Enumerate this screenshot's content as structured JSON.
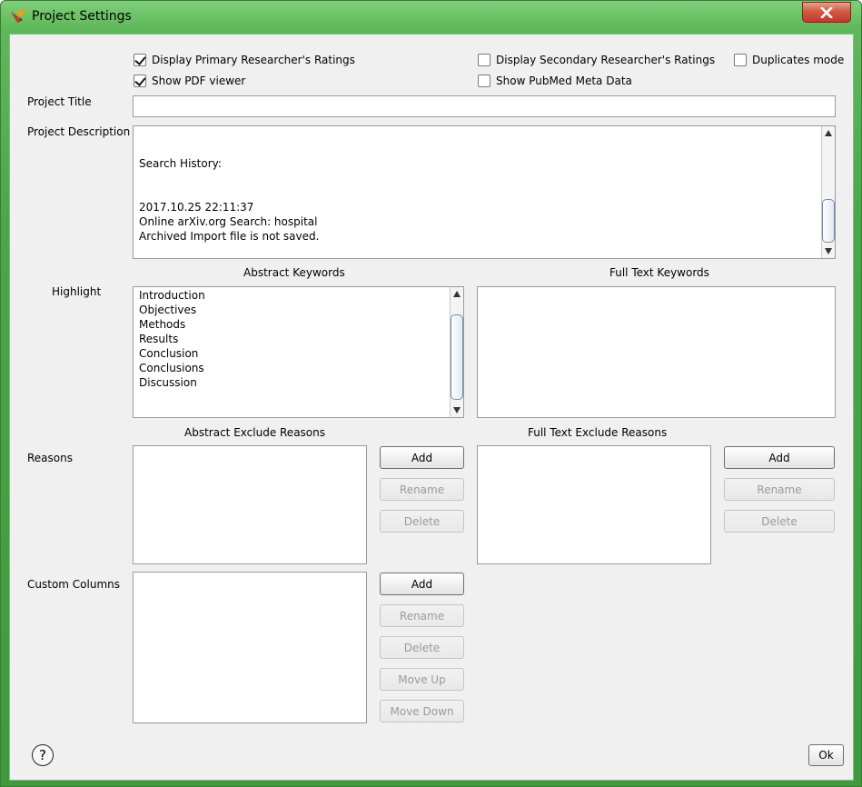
{
  "window": {
    "title": "Project Settings",
    "close_icon": "close-icon"
  },
  "checkboxes": {
    "primary_ratings": {
      "label": "Display Primary Researcher's Ratings",
      "checked": true
    },
    "show_pdf": {
      "label": "Show PDF viewer",
      "checked": true
    },
    "secondary_ratings": {
      "label": "Display Secondary Researcher's Ratings",
      "checked": false
    },
    "pubmed_meta": {
      "label": "Show PubMed Meta Data",
      "checked": false
    },
    "duplicates": {
      "label": "Duplicates mode",
      "checked": false
    }
  },
  "project_title": {
    "label": "Project Title",
    "value": ""
  },
  "project_description": {
    "label": "Project Description",
    "lines": [
      "Search History:",
      "2017.10.25 22:11:37",
      "Online arXiv.org Search: hospital",
      "Archived Import file is not saved."
    ]
  },
  "highlight": {
    "label": "Highlight",
    "abstract_header": "Abstract Keywords",
    "fulltext_header": "Full Text Keywords",
    "abstract_keywords": [
      "Introduction",
      "Objectives",
      "Methods",
      "Results",
      "Conclusion",
      "Conclusions",
      "Discussion"
    ]
  },
  "reasons": {
    "label": "Reasons",
    "abstract_header": "Abstract Exclude Reasons",
    "fulltext_header": "Full Text Exclude Reasons",
    "add": "Add",
    "rename": "Rename",
    "delete": "Delete"
  },
  "custom_columns": {
    "label": "Custom Columns",
    "add": "Add",
    "rename": "Rename",
    "delete": "Delete",
    "move_up": "Move Up",
    "move_down": "Move Down"
  },
  "footer": {
    "help": "?",
    "ok": "Ok"
  }
}
